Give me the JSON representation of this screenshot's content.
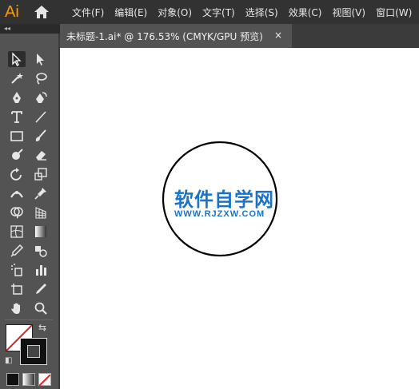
{
  "app": {
    "logo": "Ai",
    "menu": [
      "文件(F)",
      "编辑(E)",
      "对象(O)",
      "文字(T)",
      "选择(S)",
      "效果(C)",
      "视图(V)",
      "窗口(W)"
    ]
  },
  "tab": {
    "title": "未标题-1.ai* @ 176.53% (CMYK/GPU 预览)",
    "close": "×"
  },
  "canvas": {
    "watermark_main": "软件自学网",
    "watermark_url": "WWW.RJZXW.COM"
  },
  "sidebar": {
    "collapse": "◂◂"
  },
  "colors": {
    "accent": "#ff9a00",
    "watermark": "#1a73c8",
    "panel": "#535353",
    "chrome": "#323232"
  }
}
